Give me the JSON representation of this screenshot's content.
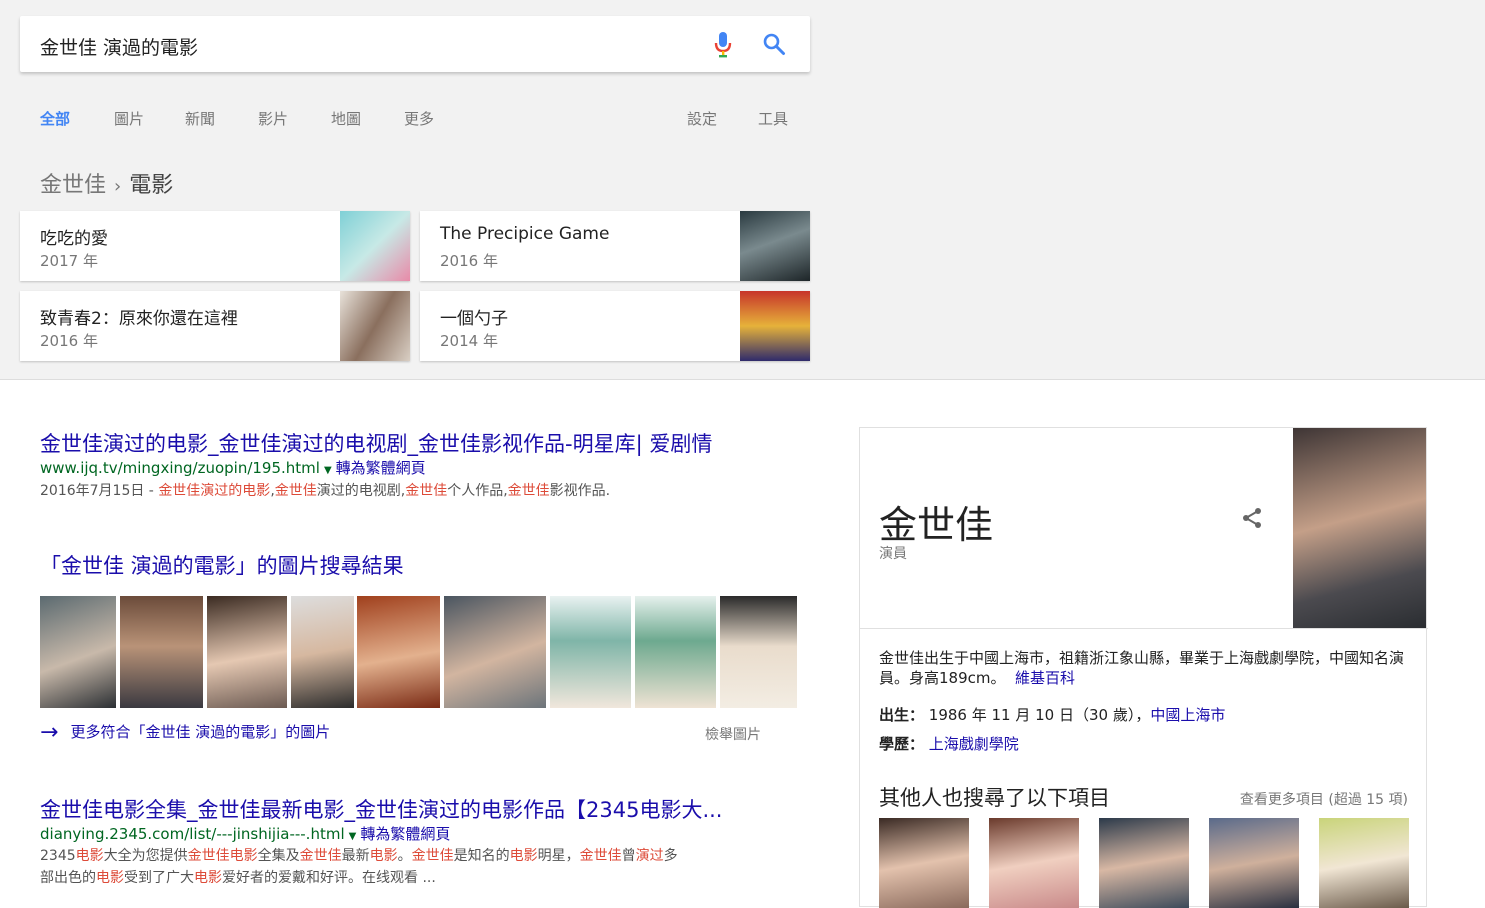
{
  "search": {
    "query": "金世佳 演過的電影"
  },
  "tabs": [
    {
      "label": "全部",
      "active": true
    },
    {
      "label": "圖片"
    },
    {
      "label": "新聞"
    },
    {
      "label": "影片"
    },
    {
      "label": "地圖"
    },
    {
      "label": "更多"
    },
    {
      "label": "設定"
    },
    {
      "label": "工具"
    }
  ],
  "breadcrumb": {
    "root": "金世佳",
    "current": "電影"
  },
  "movies": [
    {
      "title": "吃吃的愛",
      "year": "2017 年"
    },
    {
      "title": "The Precipice Game",
      "year": "2016 年"
    },
    {
      "title": "致青春2：原來你還在這裡",
      "year": "2016 年"
    },
    {
      "title": "一個勺子",
      "year": "2014 年"
    }
  ],
  "result1": {
    "title": "金世佳演过的电影_金世佳演过的电视剧_金世佳影视作品-明星库| 爱剧情",
    "url": "www.ijq.tv/mingxing/zuopin/195.html",
    "translate": "轉為繁體網頁",
    "date": "2016年7月15日 - ",
    "snippet": [
      {
        "t": "金世佳演过的电影",
        "em": true
      },
      {
        "t": ",",
        "em": false
      },
      {
        "t": "金世佳",
        "em": true
      },
      {
        "t": "演过的电视剧,",
        "em": false
      },
      {
        "t": "金世佳",
        "em": true
      },
      {
        "t": "个人作品,",
        "em": false
      },
      {
        "t": "金世佳",
        "em": true
      },
      {
        "t": "影视作品.",
        "em": false
      }
    ]
  },
  "images": {
    "heading": "「金世佳 演過的電影」的圖片搜尋結果",
    "more": "更多符合「金世佳 演過的電影」的圖片",
    "report": "檢舉圖片"
  },
  "result2": {
    "title": "金世佳电影全集_金世佳最新电影_金世佳演过的电影作品【2345电影大...",
    "url": "dianying.2345.com/list/---jinshijia---.html",
    "translate": "轉為繁體網頁",
    "snippet1": [
      {
        "t": "2345",
        "em": false
      },
      {
        "t": "电影",
        "em": true
      },
      {
        "t": "大全为您提供",
        "em": false
      },
      {
        "t": "金世佳电影",
        "em": true
      },
      {
        "t": "全集及",
        "em": false
      },
      {
        "t": "金世佳",
        "em": true
      },
      {
        "t": "最新",
        "em": false
      },
      {
        "t": "电影",
        "em": true
      },
      {
        "t": "。",
        "em": false
      },
      {
        "t": "金世佳",
        "em": true
      },
      {
        "t": "是知名的",
        "em": false
      },
      {
        "t": "电影",
        "em": true
      },
      {
        "t": "明星，",
        "em": false
      },
      {
        "t": "金世佳",
        "em": true
      },
      {
        "t": "曾",
        "em": false
      },
      {
        "t": "演过",
        "em": true
      },
      {
        "t": "多",
        "em": false
      }
    ],
    "snippet2": [
      {
        "t": "部出色的",
        "em": false
      },
      {
        "t": "电影",
        "em": true
      },
      {
        "t": "受到了广大",
        "em": false
      },
      {
        "t": "电影",
        "em": true
      },
      {
        "t": "爱好者的爱戴和好评。在线观看 ...",
        "em": false
      }
    ]
  },
  "knowledge": {
    "name": "金世佳",
    "role": "演員",
    "description": "金世佳出生于中國上海市，祖籍浙江象山縣，畢業于上海戲劇學院，中國知名演員。身高189cm。",
    "source": "維基百科",
    "born_label": "出生：",
    "born_value": "1986 年 11 月 10 日（30 歲），",
    "born_place": "中國上海市",
    "edu_label": "學歷：",
    "edu_value": "上海戲劇學院",
    "also_heading": "其他人也搜尋了以下項目",
    "also_more": "查看更多項目 (超過 15 項)"
  }
}
